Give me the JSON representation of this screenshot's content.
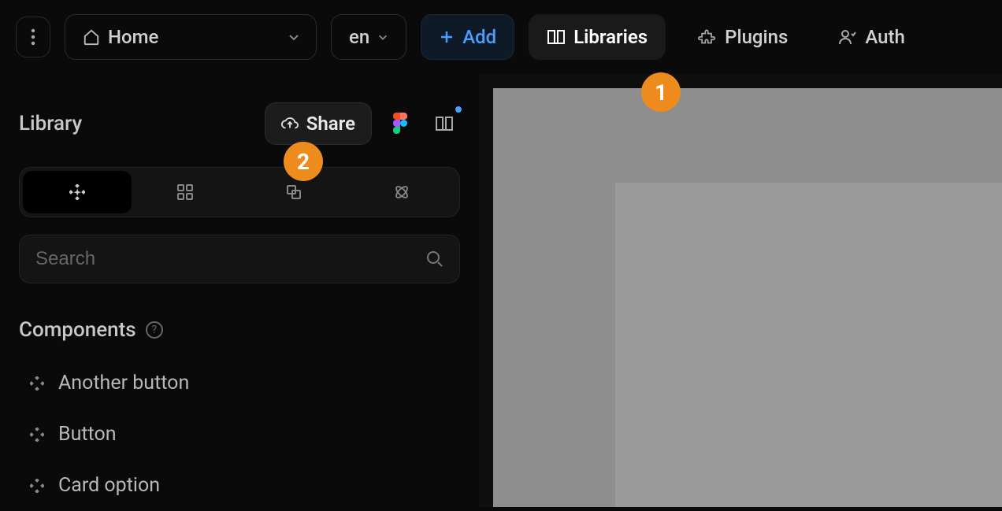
{
  "topbar": {
    "home_label": "Home",
    "lang_label": "en",
    "add_label": "Add",
    "libraries_label": "Libraries",
    "plugins_label": "Plugins",
    "auth_label": "Auth"
  },
  "sidebar": {
    "library_title": "Library",
    "share_label": "Share",
    "search_placeholder": "Search",
    "components_title": "Components",
    "components": [
      {
        "label": "Another button"
      },
      {
        "label": "Button"
      },
      {
        "label": "Card option"
      }
    ]
  },
  "annotations": {
    "badge1": "1",
    "badge2": "2"
  }
}
